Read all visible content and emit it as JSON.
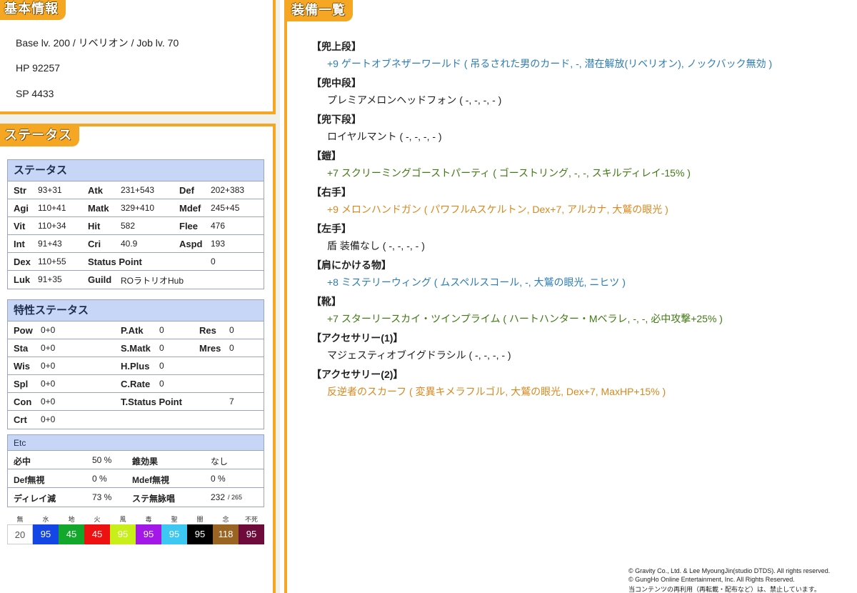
{
  "basic": {
    "title": "基本情報",
    "line1": "Base lv. 200 / リベリオン / Job lv. 70",
    "line2": "HP 92257",
    "line3": "SP 4433"
  },
  "status_panel": {
    "title": "ステータス",
    "status_header": "ステータス",
    "rows": [
      {
        "l1": "Str",
        "v1": "93+31",
        "l2": "Atk",
        "v2": "231+543",
        "l3": "Def",
        "v3": "202+383"
      },
      {
        "l1": "Agi",
        "v1": "110+41",
        "l2": "Matk",
        "v2": "329+410",
        "l3": "Mdef",
        "v3": "245+45"
      },
      {
        "l1": "Vit",
        "v1": "110+34",
        "l2": "Hit",
        "v2": "582",
        "l3": "Flee",
        "v3": "476"
      },
      {
        "l1": "Int",
        "v1": "91+43",
        "l2": "Cri",
        "v2": "40.9",
        "l3": "Aspd",
        "v3": "193"
      },
      {
        "l1": "Dex",
        "v1": "110+55",
        "l2": "Status Point",
        "v2": "0",
        "l3": "",
        "v3": ""
      },
      {
        "l1": "Luk",
        "v1": "91+35",
        "l2": "Guild",
        "v2": "ROラトリオHub",
        "l3": "",
        "v3": ""
      }
    ],
    "trait_header": "特性ステータス",
    "trait_rows": [
      {
        "l1": "Pow",
        "v1": "0+0",
        "l2": "P.Atk",
        "v2": "0",
        "l3": "Res",
        "v3": "0"
      },
      {
        "l1": "Sta",
        "v1": "0+0",
        "l2": "S.Matk",
        "v2": "0",
        "l3": "Mres",
        "v3": "0"
      },
      {
        "l1": "Wis",
        "v1": "0+0",
        "l2": "H.Plus",
        "v2": "0",
        "l3": "",
        "v3": ""
      },
      {
        "l1": "Spl",
        "v1": "0+0",
        "l2": "C.Rate",
        "v2": "0",
        "l3": "",
        "v3": ""
      },
      {
        "l1": "Con",
        "v1": "0+0",
        "l2": "T.Status Point",
        "v2": "7",
        "l3": "",
        "v3": ""
      },
      {
        "l1": "Crt",
        "v1": "0+0",
        "l2": "",
        "v2": "",
        "l3": "",
        "v3": ""
      }
    ],
    "etc_header": "Etc",
    "etc_rows": [
      {
        "l1": "必中",
        "v1": "50 %",
        "l2": "錐効果",
        "v2": "なし"
      },
      {
        "l1": "Def無視",
        "v1": "0 %",
        "l2": "Mdef無視",
        "v2": "0 %"
      },
      {
        "l1": "ディレイ減",
        "v1": "73 %",
        "l2": "ステ無詠唱",
        "v2": "232",
        "v2b": "/ 265"
      }
    ],
    "elements": [
      {
        "name": "無",
        "value": "20",
        "color": "#ffffff",
        "text": "#555555"
      },
      {
        "name": "水",
        "value": "95",
        "color": "#1446e6",
        "text": "#ffffff"
      },
      {
        "name": "地",
        "value": "45",
        "color": "#13a82b",
        "text": "#ffffff"
      },
      {
        "name": "火",
        "value": "45",
        "color": "#ee1111",
        "text": "#ffffff"
      },
      {
        "name": "風",
        "value": "95",
        "color": "#c8ef1a",
        "text": "#ffffff"
      },
      {
        "name": "毒",
        "value": "95",
        "color": "#a318e8",
        "text": "#ffffff"
      },
      {
        "name": "聖",
        "value": "95",
        "color": "#3cc8f2",
        "text": "#ffffff"
      },
      {
        "name": "闇",
        "value": "95",
        "color": "#000000",
        "text": "#ffffff"
      },
      {
        "name": "念",
        "value": "118",
        "color": "#9a6523",
        "text": "#ffffff"
      },
      {
        "name": "不死",
        "value": "95",
        "color": "#6e0b3a",
        "text": "#ffffff"
      }
    ]
  },
  "equipment": {
    "title": "装備一覧",
    "slots": [
      {
        "slot": "【兜上段】",
        "item": "+9 ゲートオブネザーワールド ( 吊るされた男のカード, -, 潜在解放(リベリオン), ノックバック無効 )",
        "color": "#2b7db5"
      },
      {
        "slot": "【兜中段】",
        "item": "プレミアメロンヘッドフォン ( -, -, -, - )",
        "color": "#222222"
      },
      {
        "slot": "【兜下段】",
        "item": "ロイヤルマント ( -, -, -, - )",
        "color": "#222222"
      },
      {
        "slot": "【鎧】",
        "item": "+7 スクリーミングゴーストパーティ ( ゴーストリング, -, -, スキルディレイ-15% )",
        "color": "#3f7a12"
      },
      {
        "slot": "【右手】",
        "item": "+9 メロンハンドガン ( パワフルAスケルトン, Dex+7, アルカナ, 大鷲の眼光 )",
        "color": "#d9871c"
      },
      {
        "slot": "【左手】",
        "item": "盾 装備なし ( -, -, -, - )",
        "color": "#222222"
      },
      {
        "slot": "【肩にかける物】",
        "item": "+8 ミステリーウィング ( ムスペルスコール, -, 大鷲の眼光, ニヒツ )",
        "color": "#2b7db5"
      },
      {
        "slot": "【靴】",
        "item": "+7 スターリースカイ・ツインプライム ( ハートハンター・Mベラレ, -, -, 必中攻撃+25% )",
        "color": "#3f7a12"
      },
      {
        "slot": "【アクセサリー(1)】",
        "item": "マジェスティオブイグドラシル ( -, -, -, - )",
        "color": "#222222"
      },
      {
        "slot": "【アクセサリー(2)】",
        "item": "反逆者のスカーフ ( 変異キメラフルゴル, 大鷲の眼光, Dex+7, MaxHP+15% )",
        "color": "#d9871c"
      }
    ]
  },
  "copyright": {
    "line1": "© Gravity Co., Ltd. & Lee MyoungJin(studio DTDS). All rights reserved.",
    "line2": "© GungHo Online Entertainment, Inc. All Rights Reserved.",
    "line3": "当コンテンツの再利用（再転載・配布など）は、禁止しています。"
  }
}
